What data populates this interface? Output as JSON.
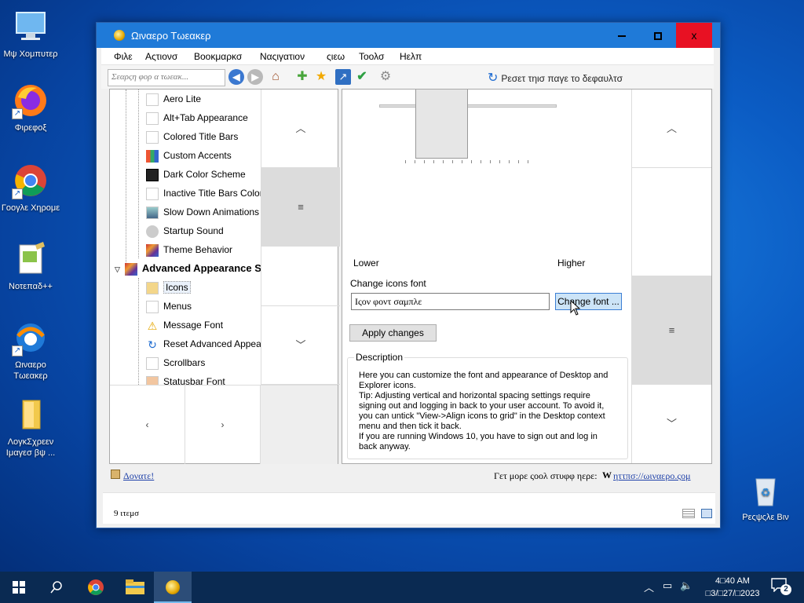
{
  "desktop": {
    "icons": [
      {
        "label": "Μψ Χομπυτερ"
      },
      {
        "label": "Φιρεφοξ"
      },
      {
        "label": "Γοογλε Χηρομε"
      },
      {
        "label": "Νοτεπαδ++"
      },
      {
        "label": "Ωιναερο Τωεακερ"
      },
      {
        "label": "ΛογκΣχρεεν Ιμαγεσ βψ ..."
      },
      {
        "label": "Ρεςψςλε Βιν"
      }
    ]
  },
  "window": {
    "title": "Ωιναερο Τωεακερ",
    "close_glyph": "x",
    "menu": [
      "Φιλε",
      "Αςτιονσ",
      "Βοοκμαρκσ",
      "Ναςιγατιον",
      "ςιεω",
      "Τοολσ",
      "Ηελπ"
    ],
    "toolbar": {
      "search_placeholder": "Σεαρςη φορ α τωεακ...",
      "reset_label": "Ρεσετ τηισ παγε το δεφαυλτσ"
    },
    "tree": {
      "items": [
        {
          "label": "Aero Lite"
        },
        {
          "label": "Alt+Tab Appearance"
        },
        {
          "label": "Colored Title Bars"
        },
        {
          "label": "Custom Accents"
        },
        {
          "label": "Dark Color Scheme"
        },
        {
          "label": "Inactive Title Bars Color"
        },
        {
          "label": "Slow Down Animations"
        },
        {
          "label": "Startup Sound"
        },
        {
          "label": "Theme Behavior"
        }
      ],
      "group_label": "Advanced Appearance S",
      "sub_items": [
        {
          "label": "Icons"
        },
        {
          "label": "Menus"
        },
        {
          "label": "Message Font"
        },
        {
          "label": "Reset Advanced Appeara"
        },
        {
          "label": "Scrollbars"
        },
        {
          "label": "Statusbar Font"
        }
      ]
    },
    "content": {
      "lower_label": "Lower",
      "higher_label": "Higher",
      "change_font_label": "Change icons font",
      "font_sample": "Ιςον φοντ σαμπλε",
      "change_font_button": "Change font ...",
      "apply_button": "Apply changes",
      "description_title": "Description",
      "description_lines": [
        "Here you can customize the font and appearance of Desktop and Explorer icons.",
        "Tip: Adjusting vertical and horizontal spacing settings require signing out and logging in back to your user account. To avoid it, you can untick \"View->Align icons to grid\" in the Desktop context menu and then tick it back.",
        "If you are running Windows 10, you have to sign out and log in back anyway."
      ]
    },
    "status": {
      "donate": "Δονατε!",
      "more_text": "Γετ μορε ςοολ στυφφ ηερε:",
      "site": "ηττπσ://ωιναερο.ςομ"
    },
    "explorer": {
      "items_count": "9 ιτεμσ"
    }
  },
  "taskbar": {
    "time": "4□40 AM",
    "date": "□3/□27/□2023",
    "notification_count": "2"
  }
}
